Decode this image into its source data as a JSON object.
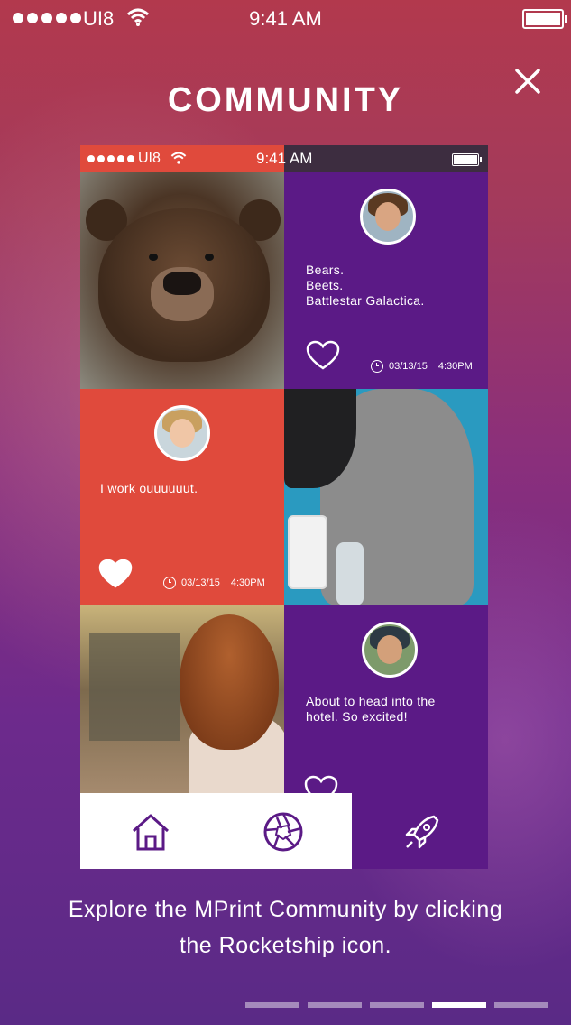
{
  "status_bar": {
    "carrier": "UI8",
    "time": "9:41 AM"
  },
  "header": {
    "title": "COMMUNITY"
  },
  "mockup": {
    "status_bar": {
      "carrier": "UI8",
      "time": "9:41 AM"
    },
    "posts": [
      {
        "text": "Bears.\nBeets.\nBattlestar Galactica.",
        "date": "03/13/15",
        "time": "4:30PM",
        "liked": false
      },
      {
        "text": "I work ouuuuuut.",
        "date": "03/13/15",
        "time": "4:30PM",
        "liked": true
      },
      {
        "text": "About to head into the\nhotel. So excited!",
        "liked": false
      }
    ]
  },
  "caption": "Explore the MPrint Community by clicking\nthe Rocketship icon.",
  "pager": {
    "count": 5,
    "active_index": 3
  },
  "colors": {
    "accent_red": "#e04a3c",
    "accent_purple": "#5b1a86",
    "nav_icon": "#5b1a86"
  },
  "icons": [
    "close-icon",
    "home-icon",
    "camera-aperture-icon",
    "rocket-icon",
    "heart-icon",
    "clock-icon",
    "wifi-icon",
    "battery-icon"
  ]
}
